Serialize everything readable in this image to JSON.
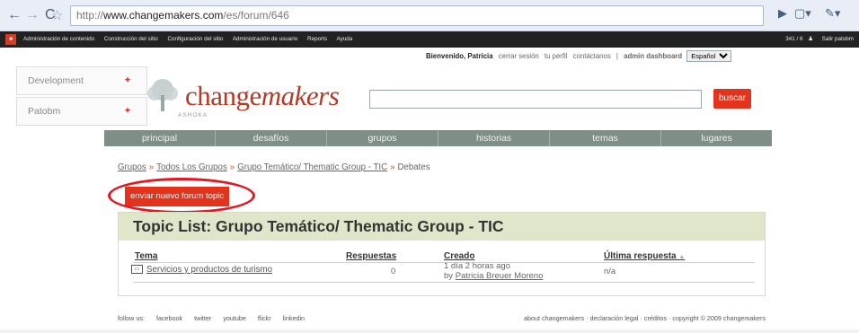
{
  "browser": {
    "url_prefix": "http://",
    "url_domain": "www.changemakers.com",
    "url_path": "/es/forum/646"
  },
  "adminbar": {
    "items": [
      "Administración de contenido",
      "Construcción del sitio",
      "Configuración del sitio",
      "Administración de usuario",
      "Reports",
      "Ayuda"
    ],
    "right_count": "341 / 6",
    "right_link": "Salir patobm"
  },
  "userbar": {
    "welcome": "Bienvenido, Patricia",
    "logout": "cerrar sesión",
    "profile": "tu perfil",
    "contact": "contáctanos",
    "separator": "|",
    "admin": "admin dashboard",
    "language": "Español"
  },
  "side_tabs": [
    "Development",
    "Patobm"
  ],
  "header": {
    "brand_a": "change",
    "brand_b": "makers",
    "brand_sub": "ASHOKA",
    "search_button": "buscar"
  },
  "nav": [
    "principal",
    "desafíos",
    "grupos",
    "historias",
    "temas",
    "lugares"
  ],
  "breadcrumb": {
    "items": [
      "Grupos",
      "Todos Los Grupos",
      "Grupo Temático/ Thematic Group - TIC"
    ],
    "sep": "»",
    "current": "Debates"
  },
  "new_topic_button": "enviar nuevo forum topic",
  "topic_list": {
    "title": "Topic List: Grupo Temático/ Thematic Group - TIC",
    "columns": [
      "Tema",
      "Respuestas",
      "Creado",
      "Última respuesta"
    ],
    "sort_indicator": "▲",
    "rows": [
      {
        "topic": "Servicios y productos de turismo",
        "replies": "0",
        "created_ago": "1 día 2 horas ago",
        "created_by_prefix": "by",
        "created_by": "Patricia Breuer Moreno",
        "last_reply": "n/a"
      }
    ]
  },
  "footer": {
    "follow_label": "follow us:",
    "links": [
      "facebook",
      "twitter",
      "youtube",
      "flickr",
      "linkedin"
    ],
    "right": "about changemakers · declaración legal · créditos · copyright © 2009 changemakers"
  }
}
